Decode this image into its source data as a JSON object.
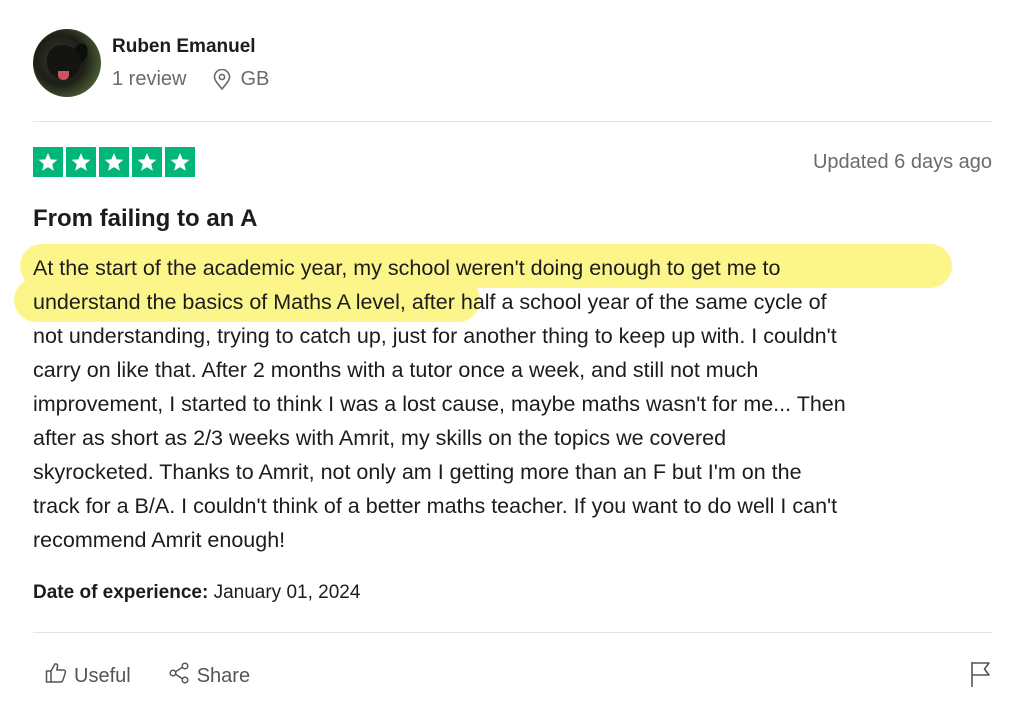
{
  "reviewer": {
    "name": "Ruben Emanuel",
    "review_count": "1 review",
    "country": "GB"
  },
  "review": {
    "rating_stars": 5,
    "star_color": "#00b67a",
    "updated": "Updated 6 days ago",
    "title": "From failing to an A",
    "highlight_color": "#fbf58a",
    "body_lines": [
      "At the start of the academic year, my school weren't doing enough to get me to",
      "understand the basics of Maths A level, after half a school year of the same cycle of",
      "not understanding, trying to catch up, just for another thing to keep up with. I couldn't",
      "carry on like that. After 2 months with a tutor once a week, and still not much",
      "improvement, I started to think I was a lost cause, maybe maths wasn't for me... Then",
      "after as short as 2/3 weeks with Amrit, my skills on the topics we covered",
      "skyrocketed. Thanks to Amrit, not only am I getting more than an F but I'm on the",
      "track for a B/A. I couldn't think of a better maths teacher. If you want to do well I can't",
      "recommend Amrit enough!"
    ],
    "experience_label": "Date of experience:",
    "experience_date": "January 01, 2024"
  },
  "actions": {
    "useful_label": "Useful",
    "share_label": "Share",
    "icons": [
      "thumbs-up-icon",
      "share-icon",
      "flag-icon",
      "location-pin-icon",
      "star-icon"
    ]
  }
}
